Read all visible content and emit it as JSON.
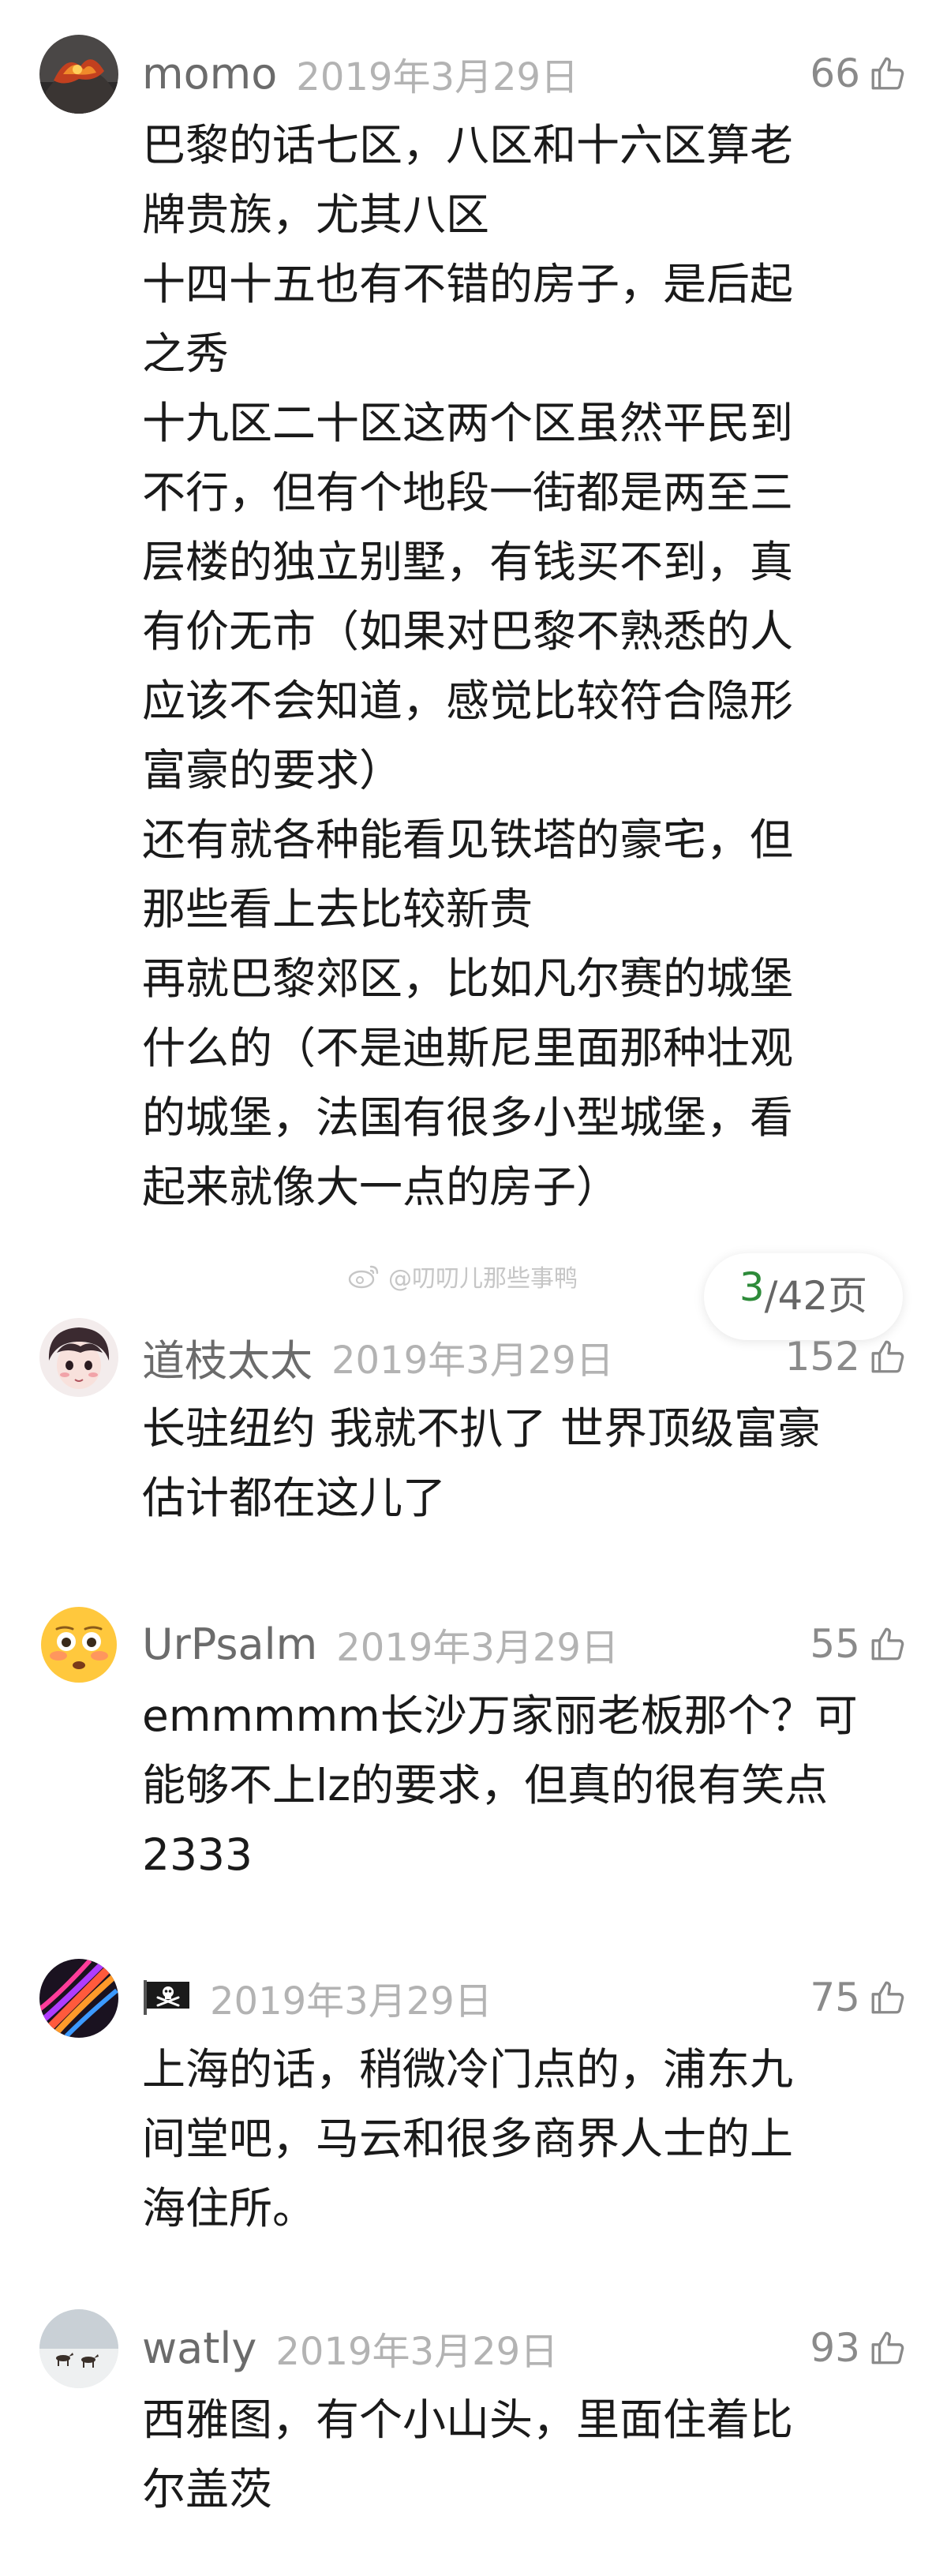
{
  "colors": {
    "page_current": "#2e8b3a",
    "meta_gray": "#b3b3b3",
    "text": "#1a1a1a"
  },
  "comments": [
    {
      "username": "momo",
      "date": "2019年3月29日",
      "likes": "66",
      "avatar_icon": "volcano-avatar",
      "text": "巴黎的话七区，八区和十六区算老\n牌贵族，尤其八区\n十四十五也有不错的房子，是后起\n之秀\n十九区二十区这两个区虽然平民到\n不行，但有个地段一街都是两至三\n层楼的独立别墅，有钱买不到，真\n有价无市（如果对巴黎不熟悉的人\n应该不会知道，感觉比较符合隐形\n富豪的要求）\n还有就各种能看见铁塔的豪宅，但\n那些看上去比较新贵\n再就巴黎郊区，比如凡尔赛的城堡\n什么的（不是迪斯尼里面那种壮观\n的城堡，法国有很多小型城堡，看\n起来就像大一点的房子）"
    },
    {
      "username": "道枝太太",
      "date": "2019年3月29日",
      "likes": "152",
      "avatar_icon": "anime-face-avatar",
      "text": "长驻纽约 我就不扒了 世界顶级富豪\n估计都在这儿了"
    },
    {
      "username": "UrPsalm",
      "date": "2019年3月29日",
      "likes": "55",
      "avatar_icon": "flushed-emoji-avatar",
      "text": "emmmmm长沙万家丽老板那个？可\n能够不上lz的要求，但真的很有笑点\n2333"
    },
    {
      "username": "",
      "date": "2019年3月29日",
      "likes": "75",
      "avatar_icon": "gradient-swirl-avatar",
      "name_icon": "pirate-flag-icon",
      "text": "上海的话，稍微冷门点的，浦东九\n间堂吧，马云和很多商界人士的上\n海住所。"
    },
    {
      "username": "watly",
      "date": "2019年3月29日",
      "likes": "93",
      "avatar_icon": "snow-horses-avatar",
      "text": "西雅图，有个小山头，里面住着比\n尔盖茨"
    }
  ],
  "watermark": {
    "text": "@叨叨儿那些事鸭",
    "icon": "weibo-icon"
  },
  "pagination": {
    "current": "3",
    "total_text": "/42页"
  }
}
